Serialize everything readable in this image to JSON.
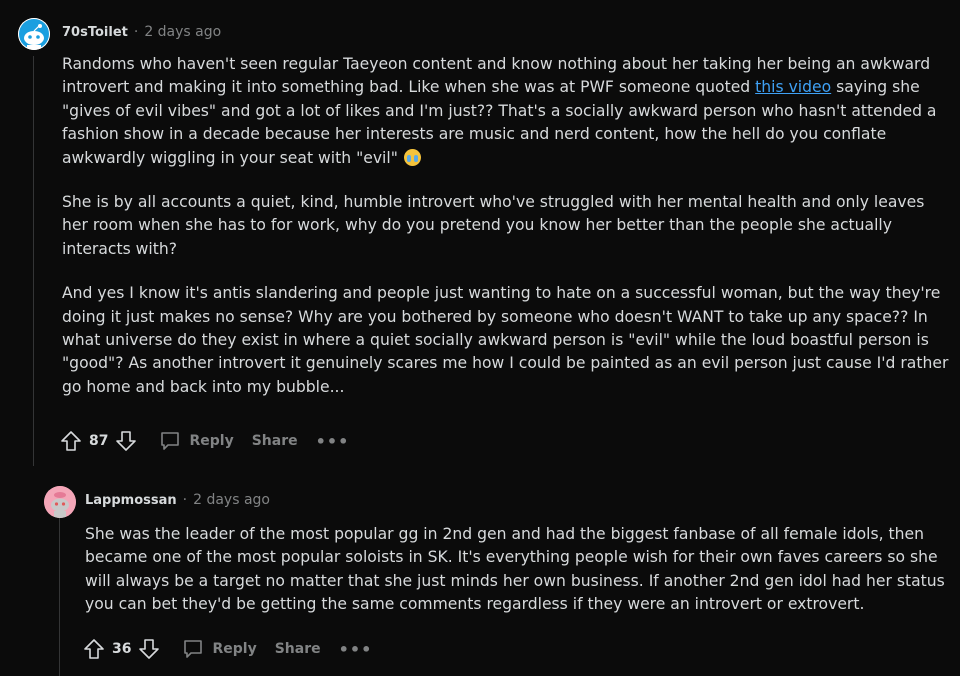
{
  "comments": [
    {
      "author": "70sToilet",
      "separator": "·",
      "time": "2 days ago",
      "paragraphs": [
        {
          "before": "Randoms who haven't seen regular Taeyeon content and know nothing about her taking her being an awkward introvert and making it into something bad. Like when she was at PWF someone quoted ",
          "link": "this video",
          "after": " saying she \"gives of evil vibes\" and got a lot of likes and I'm just?? That's a socially awkward person who hasn't attended a fashion show in a decade because her interests are music and nerd content, how the hell do you conflate awkwardly wiggling in your seat with \"evil\""
        },
        {
          "text": "She is by all accounts a quiet, kind, humble introvert who've struggled with her mental health and only leaves her room when she has to for work, why do you pretend you know her better than the people she actually interacts with?"
        },
        {
          "text": "And yes I know it's antis slandering and people just wanting to hate on a successful woman, but the way they're doing it just makes no sense? Why are you bothered by someone who doesn't WANT to take up any space?? In what universe do they exist in where a quiet socially awkward person is \"evil\" while the loud boastful person is \"good\"? As another introvert it genuinely scares me how I could be painted as an evil person just cause I'd rather go home and back into my bubble..."
        }
      ],
      "score": "87",
      "reply_label": "Reply",
      "share_label": "Share",
      "more_label": "•••"
    },
    {
      "author": "Lappmossan",
      "separator": "·",
      "time": "2 days ago",
      "paragraphs": [
        {
          "text": "She was the leader of the most popular gg in 2nd gen and had the biggest fanbase of all female idols, then became one of the most popular soloists in SK. It's everything people wish for their own faves careers so she will always be a target no matter that she just minds her own business. If another 2nd gen idol had her status you can bet they'd be getting the same comments regardless if they were an introvert or extrovert."
        }
      ],
      "score": "36",
      "reply_label": "Reply",
      "share_label": "Share",
      "more_label": "•••"
    }
  ],
  "colors": {
    "background": "#0b0b0b",
    "text": "#d7dadc",
    "muted": "#818384",
    "link": "#3fa1f5",
    "avatar2": "#f4a6b8"
  }
}
